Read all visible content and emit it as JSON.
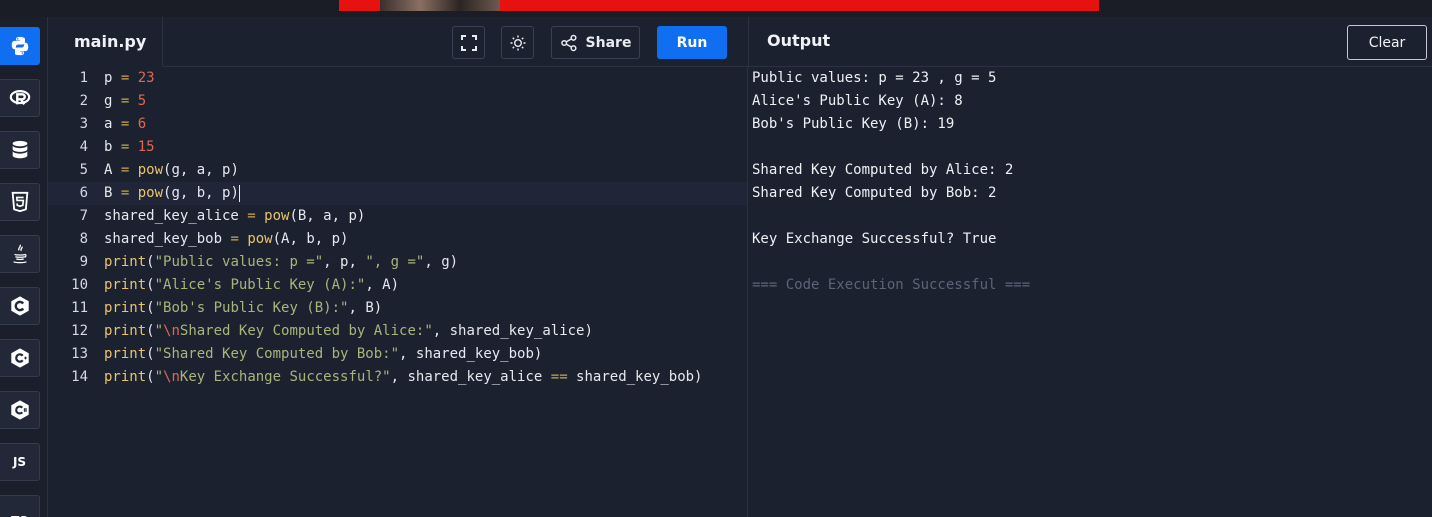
{
  "editor": {
    "filename": "main.py",
    "share_label": "Share",
    "run_label": "Run",
    "lines": [
      {
        "num": "1",
        "tokens": [
          {
            "t": "p",
            "c": ""
          },
          {
            "t": " = ",
            "c": "op"
          },
          {
            "t": "23",
            "c": "num"
          }
        ]
      },
      {
        "num": "2",
        "tokens": [
          {
            "t": "g",
            "c": ""
          },
          {
            "t": " = ",
            "c": "op"
          },
          {
            "t": "5",
            "c": "num"
          }
        ]
      },
      {
        "num": "3",
        "tokens": [
          {
            "t": "a",
            "c": ""
          },
          {
            "t": " = ",
            "c": "op"
          },
          {
            "t": "6",
            "c": "num"
          }
        ]
      },
      {
        "num": "4",
        "tokens": [
          {
            "t": "b",
            "c": ""
          },
          {
            "t": " = ",
            "c": "op"
          },
          {
            "t": "15",
            "c": "num"
          }
        ]
      },
      {
        "num": "5",
        "tokens": [
          {
            "t": "A",
            "c": ""
          },
          {
            "t": " = ",
            "c": "op"
          },
          {
            "t": "pow",
            "c": "fn"
          },
          {
            "t": "(g, a, p)",
            "c": ""
          }
        ]
      },
      {
        "num": "6",
        "tokens": [
          {
            "t": "B",
            "c": ""
          },
          {
            "t": " = ",
            "c": "op"
          },
          {
            "t": "pow",
            "c": "fn"
          },
          {
            "t": "(g, b, p)",
            "c": ""
          }
        ],
        "current": true
      },
      {
        "num": "7",
        "tokens": [
          {
            "t": "shared_key_alice",
            "c": ""
          },
          {
            "t": " = ",
            "c": "op"
          },
          {
            "t": "pow",
            "c": "fn"
          },
          {
            "t": "(B, a, p)",
            "c": ""
          }
        ]
      },
      {
        "num": "8",
        "tokens": [
          {
            "t": "shared_key_bob",
            "c": ""
          },
          {
            "t": " = ",
            "c": "op"
          },
          {
            "t": "pow",
            "c": "fn"
          },
          {
            "t": "(A, b, p)",
            "c": ""
          }
        ]
      },
      {
        "num": "9",
        "tokens": [
          {
            "t": "print",
            "c": "fn"
          },
          {
            "t": "(",
            "c": ""
          },
          {
            "t": "\"Public values: p =\"",
            "c": "str"
          },
          {
            "t": ", p, ",
            "c": ""
          },
          {
            "t": "\", g =\"",
            "c": "str"
          },
          {
            "t": ", g)",
            "c": ""
          }
        ]
      },
      {
        "num": "10",
        "tokens": [
          {
            "t": "print",
            "c": "fn"
          },
          {
            "t": "(",
            "c": ""
          },
          {
            "t": "\"Alice's Public Key (A):\"",
            "c": "str"
          },
          {
            "t": ", A)",
            "c": ""
          }
        ]
      },
      {
        "num": "11",
        "tokens": [
          {
            "t": "print",
            "c": "fn"
          },
          {
            "t": "(",
            "c": ""
          },
          {
            "t": "\"Bob's Public Key (B):\"",
            "c": "str"
          },
          {
            "t": ", B)",
            "c": ""
          }
        ]
      },
      {
        "num": "12",
        "tokens": [
          {
            "t": "print",
            "c": "fn"
          },
          {
            "t": "(",
            "c": ""
          },
          {
            "t": "\"",
            "c": "str"
          },
          {
            "t": "\\n",
            "c": "esc"
          },
          {
            "t": "Shared Key Computed by Alice:\"",
            "c": "str"
          },
          {
            "t": ", shared_key_alice)",
            "c": ""
          }
        ]
      },
      {
        "num": "13",
        "tokens": [
          {
            "t": "print",
            "c": "fn"
          },
          {
            "t": "(",
            "c": ""
          },
          {
            "t": "\"Shared Key Computed by Bob:\"",
            "c": "str"
          },
          {
            "t": ", shared_key_bob)",
            "c": ""
          }
        ]
      },
      {
        "num": "14",
        "tokens": [
          {
            "t": "print",
            "c": "fn"
          },
          {
            "t": "(",
            "c": ""
          },
          {
            "t": "\"",
            "c": "str"
          },
          {
            "t": "\\n",
            "c": "esc"
          },
          {
            "t": "Key Exchange Successful?\"",
            "c": "str"
          },
          {
            "t": ", shared_key_alice ",
            "c": ""
          },
          {
            "t": "==",
            "c": "op"
          },
          {
            "t": " shared_key_bob)",
            "c": ""
          }
        ]
      }
    ]
  },
  "output": {
    "title": "Output",
    "clear_label": "Clear",
    "lines": [
      {
        "text": "Public values: p = 23 , g = 5",
        "kind": "normal"
      },
      {
        "text": "Alice's Public Key (A): 8",
        "kind": "normal"
      },
      {
        "text": "Bob's Public Key (B): 19",
        "kind": "normal"
      },
      {
        "text": "",
        "kind": "normal"
      },
      {
        "text": "Shared Key Computed by Alice: 2",
        "kind": "normal"
      },
      {
        "text": "Shared Key Computed by Bob: 2",
        "kind": "normal"
      },
      {
        "text": "",
        "kind": "normal"
      },
      {
        "text": "Key Exchange Successful? True",
        "kind": "normal"
      },
      {
        "text": "",
        "kind": "normal"
      },
      {
        "text": "=== Code Execution Successful ===",
        "kind": "success"
      }
    ]
  },
  "sidebar": {
    "languages": [
      {
        "name": "python",
        "icon": "python-icon",
        "active": true
      },
      {
        "name": "r",
        "icon": "r-icon"
      },
      {
        "name": "sql",
        "icon": "database-icon"
      },
      {
        "name": "html",
        "icon": "html5-icon"
      },
      {
        "name": "java",
        "icon": "java-icon"
      },
      {
        "name": "c",
        "icon": "c-icon"
      },
      {
        "name": "cpp",
        "icon": "cpp-icon"
      },
      {
        "name": "csharp",
        "icon": "csharp-icon"
      },
      {
        "name": "javascript",
        "icon": "js-icon",
        "label": "JS"
      },
      {
        "name": "typescript",
        "icon": "ts-icon",
        "label": "TS"
      }
    ]
  },
  "colors": {
    "accent": "#0f6ff0",
    "banner": "#e5120f",
    "background": "#1c2130"
  }
}
